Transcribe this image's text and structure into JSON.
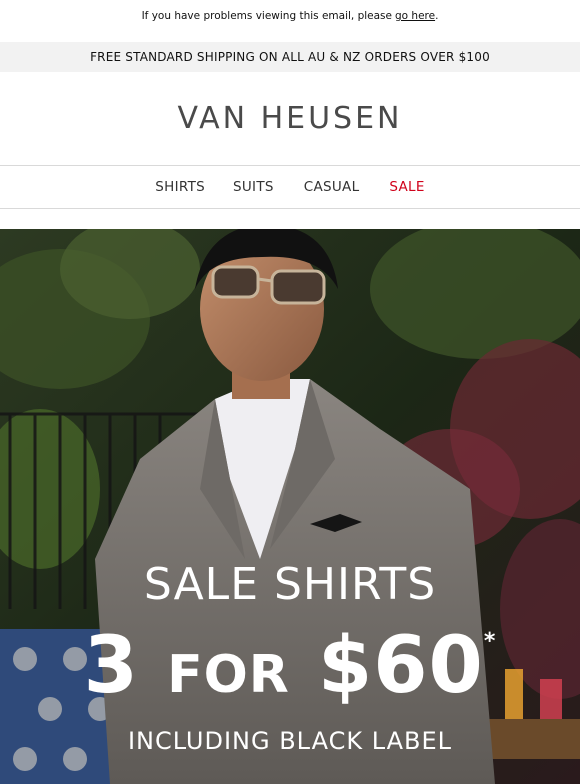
{
  "preheader": {
    "text": "If you have problems viewing this email, please",
    "link": "go here",
    "suffix": "."
  },
  "shipping_banner": "FREE STANDARD SHIPPING ON ALL AU & NZ ORDERS OVER $100",
  "brand": {
    "logo_text": "VAN HEUSEN"
  },
  "nav": {
    "items": [
      {
        "label": "SHIRTS"
      },
      {
        "label": "SUITS"
      },
      {
        "label": "CASUAL"
      },
      {
        "label": "SALE"
      }
    ]
  },
  "hero": {
    "headline": "SALE SHIRTS",
    "offer_number": "3",
    "offer_word": "FOR",
    "offer_price": "$60",
    "asterisk": "*",
    "subline": "INCLUDING BLACK LABEL"
  },
  "colors": {
    "sale_red": "#d0021b",
    "logo_grey": "#4a4a4a",
    "banner_bg": "#f2f2f2"
  }
}
